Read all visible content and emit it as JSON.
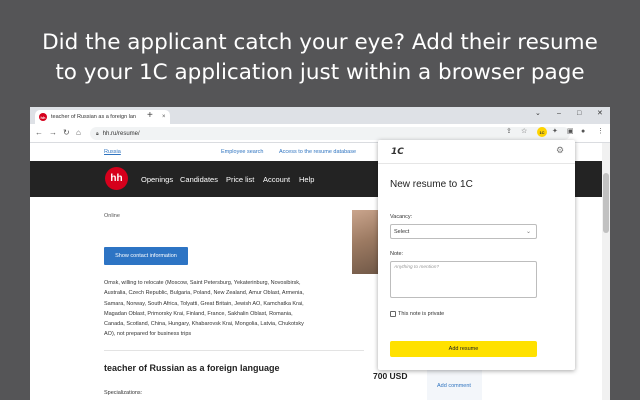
{
  "headline": {
    "line1": "Did the applicant catch your eye? Add their resume",
    "line2": "to your 1C application just within a browser page"
  },
  "browser": {
    "tab": {
      "favicon_text": "hh",
      "title": "teacher of Russian as a foreign lan",
      "close": "×"
    },
    "new_tab": "+",
    "window_controls": {
      "chevron": "⌄",
      "minimize": "–",
      "maximize": "□",
      "close": "✕"
    },
    "nav": {
      "back": "←",
      "forward": "→",
      "reload": "↻",
      "home": "⌂"
    },
    "url": "hh.ru/resume/",
    "extension_badge": "1C"
  },
  "site": {
    "region_link": "Russia",
    "employee_search": "Employee search",
    "resume_db": "Access to the resume database",
    "logo": "hh",
    "nav": [
      "Openings",
      "Candidates",
      "Price list",
      "Account",
      "Help"
    ]
  },
  "resume": {
    "status": "Online",
    "contact_button": "Show contact information",
    "relocation_lines": [
      "Omsk, willing to relocate (Moscow, Saint Petersburg, Yekaterinburg, Novosibirsk,",
      "Australia, Czech Republic, Bulgaria, Poland, New Zealand, Amur Oblast, Armenia,",
      "Samara, Norway, South Africa, Tolyatti, Great Britain, Jewish AO, Kamchatka Krai,",
      "Magadan Oblast, Primorsky Krai, Finland, France, Sakhalin Oblast, Romania,",
      "Canada, Scotland, China, Hungary, Khabarovsk Krai, Mongolia, Latvia, Chukotsky",
      "AO), not prepared for business trips"
    ],
    "position": "teacher of Russian as a foreign language",
    "salary": "700 USD",
    "specializations": "Specializations:",
    "add_comment": "Add comment"
  },
  "popup": {
    "logo": "1С",
    "title": "New resume to 1C",
    "vacancy_label": "Vacancy:",
    "vacancy_value": "Select",
    "note_label": "Note:",
    "note_placeholder": "Anything to mention?",
    "private_label": "This note is private",
    "private_checked": false,
    "add_button": "Add resume"
  },
  "colors": {
    "background": "#555557",
    "hh_red": "#d6001c",
    "site_nav": "#232323",
    "link_blue": "#2f74c0",
    "button_blue": "#2d74c4",
    "accent_yellow": "#ffe100"
  }
}
